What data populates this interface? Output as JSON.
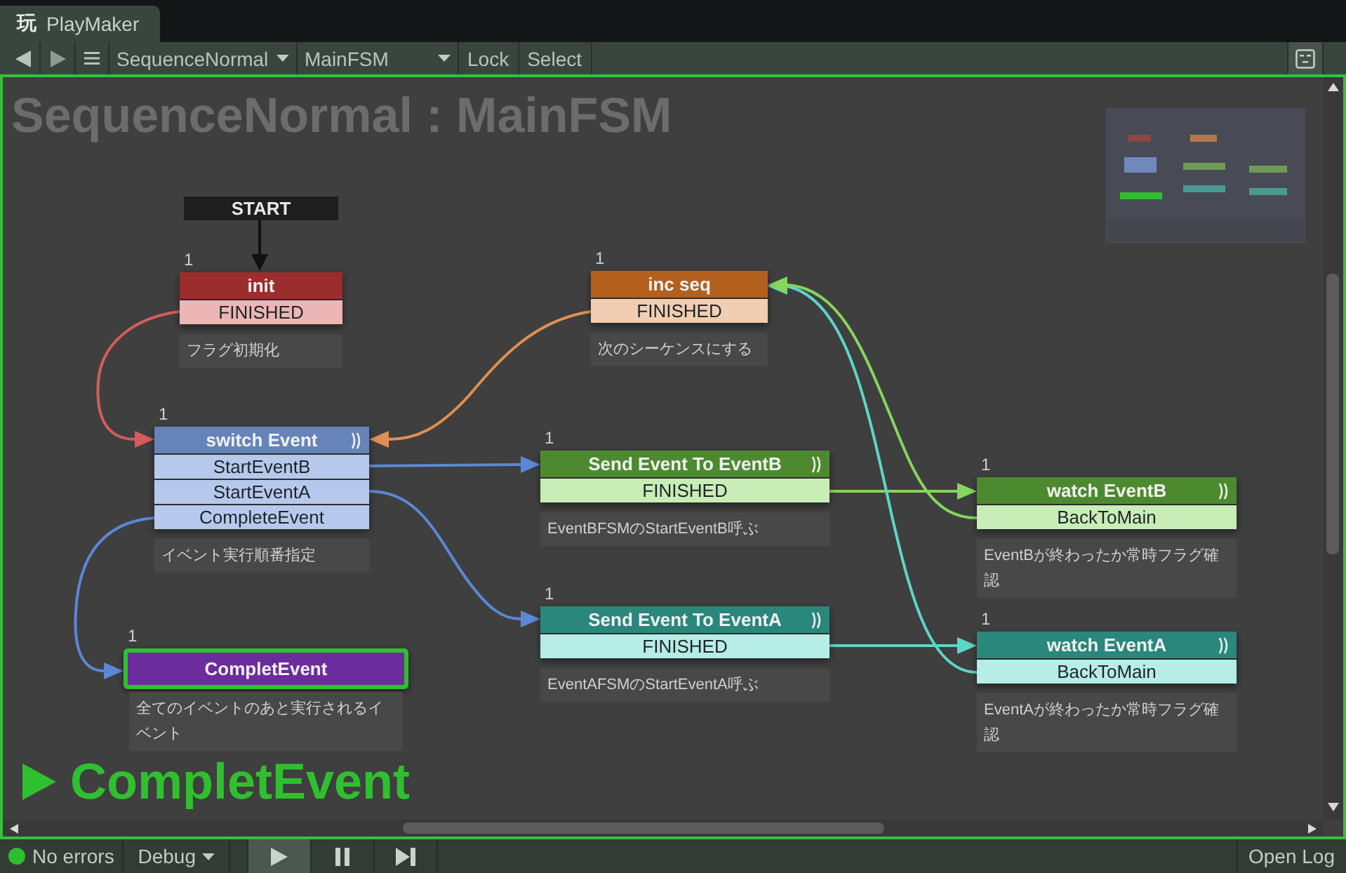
{
  "tab": {
    "glyph": "玩",
    "label": "PlayMaker"
  },
  "toolbar": {
    "owner": "SequenceNormal",
    "fsm": "MainFSM",
    "buttons": [
      "Lock",
      "Select"
    ]
  },
  "graph": {
    "title": "SequenceNormal : MainFSM",
    "start": "START",
    "states": [
      {
        "count": "1",
        "name": "init",
        "color": "#9b2d2d",
        "arcs_icon": false,
        "selected": false,
        "transitions": [
          "FINISHED"
        ],
        "comment": "フラグ初期化"
      },
      {
        "count": "1",
        "name": "inc seq",
        "color": "#b3601f",
        "arcs_icon": false,
        "selected": false,
        "transitions": [
          "FINISHED"
        ],
        "comment": "次のシーケンスにする"
      },
      {
        "count": "1",
        "name": "switch Event",
        "color": "#6683ba",
        "arcs_icon": true,
        "selected": false,
        "transitions": [
          "StartEventB",
          "StartEventA",
          "CompleteEvent"
        ],
        "comment": "イベント実行順番指定"
      },
      {
        "count": "1",
        "name": "Send Event To EventB",
        "color": "#4d8a2f",
        "arcs_icon": true,
        "selected": false,
        "transitions": [
          "FINISHED"
        ],
        "comment": "EventBFSMのStartEventB呼ぶ"
      },
      {
        "count": "1",
        "name": "watch EventB",
        "color": "#4d8a2f",
        "arcs_icon": true,
        "selected": false,
        "transitions": [
          "BackToMain"
        ],
        "comment": "EventBが終わったか常時フラグ確認"
      },
      {
        "count": "1",
        "name": "CompletEvent",
        "color": "#6b2c9c",
        "arcs_icon": false,
        "selected": true,
        "comment": "全てのイベントのあと実行されるイベント"
      },
      {
        "count": "1",
        "name": "Send Event To EventA",
        "color": "#2a877c",
        "arcs_icon": true,
        "selected": false,
        "transitions": [
          "FINISHED"
        ],
        "comment": "EventAFSMのStartEventA呼ぶ"
      },
      {
        "count": "1",
        "name": "watch EventA",
        "color": "#2a877c",
        "arcs_icon": true,
        "selected": false,
        "transitions": [
          "BackToMain"
        ],
        "comment": "EventAが終わったか常時フラグ確認"
      }
    ],
    "active_state": "CompletEvent"
  },
  "status_bar": {
    "errors": "No errors",
    "mode": "Debug",
    "controls": [
      {
        "kind": "play",
        "selected": true
      },
      {
        "kind": "pause",
        "selected": false
      },
      {
        "kind": "step",
        "selected": false
      }
    ],
    "log_button": "Open Log"
  }
}
